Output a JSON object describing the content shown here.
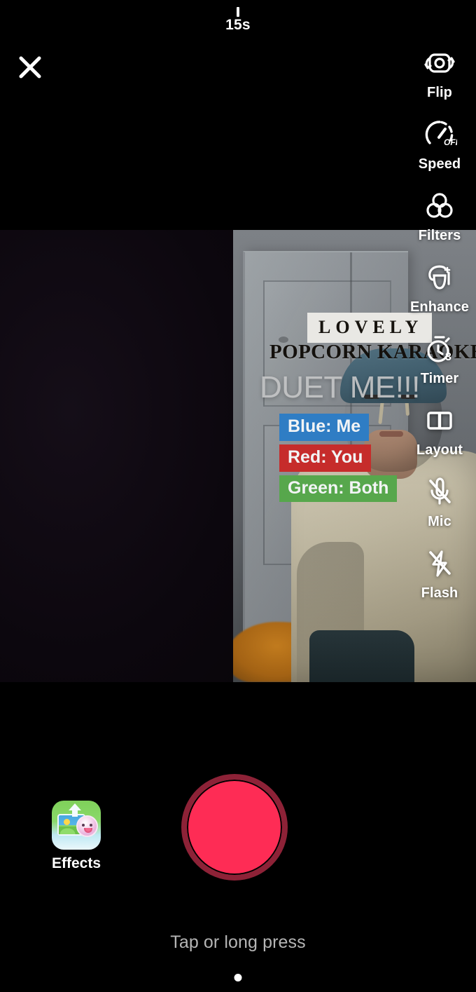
{
  "app": {
    "screen_name": "TikTok Duet Camera"
  },
  "top": {
    "duration_label": "15s",
    "close_icon": "close-x-icon"
  },
  "tools": [
    {
      "id": "flip",
      "label": "Flip",
      "icon": "camera-flip-icon"
    },
    {
      "id": "speed",
      "label": "Speed",
      "icon": "speedometer-icon",
      "badge": "OFF"
    },
    {
      "id": "filters",
      "label": "Filters",
      "icon": "three-circles-filter-icon"
    },
    {
      "id": "enhance",
      "label": "Enhance",
      "icon": "face-sparkle-enhance-icon"
    },
    {
      "id": "timer",
      "label": "Timer",
      "icon": "stopwatch-icon",
      "badge": "3"
    },
    {
      "id": "layout",
      "label": "Layout",
      "icon": "split-layout-icon"
    },
    {
      "id": "mic",
      "label": "Mic",
      "icon": "microphone-muted-icon"
    },
    {
      "id": "flash",
      "label": "Flash",
      "icon": "flash-off-icon"
    }
  ],
  "duet_overlay": {
    "headline_badge": "LOVELY",
    "headline": "POPCORN KARAOKE",
    "call_to_action": "DUET ME!!!",
    "tags": [
      {
        "text": "Blue: Me",
        "color": "#2f7dc4"
      },
      {
        "text": "Red: You",
        "color": "#c62c2b"
      },
      {
        "text": "Green: Both",
        "color": "#57a74c"
      }
    ]
  },
  "bottom": {
    "effects_label": "Effects",
    "effects_icon": "effects-sticker-icon",
    "record_button": "record-button",
    "record_color": "#fe2c55",
    "record_ring_color": "#8d2237",
    "hint_text": "Tap or long press"
  }
}
